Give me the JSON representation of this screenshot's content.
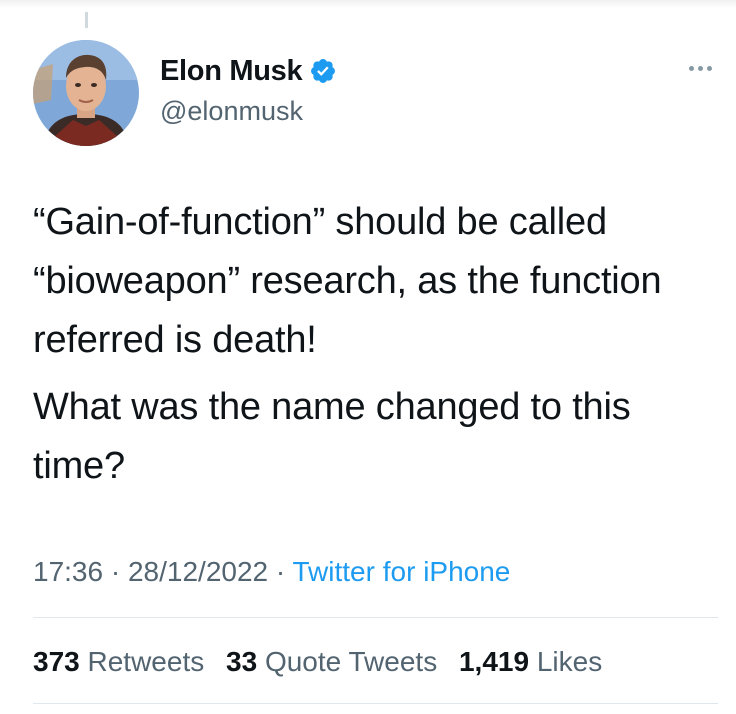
{
  "tweet": {
    "author": {
      "display_name": "Elon Musk",
      "handle": "@elonmusk",
      "verified": true
    },
    "text": [
      "“Gain-of-function” should be called “bioweapon” research, as the function referred is death!",
      "What was the name changed to this time?"
    ],
    "time": "17:36",
    "date": "28/12/2022",
    "separator": "·",
    "source": "Twitter for iPhone",
    "stats": {
      "retweets_count": "373",
      "retweets_label": "Retweets",
      "quotes_count": "33",
      "quotes_label": "Quote Tweets",
      "likes_count": "1,419",
      "likes_label": "Likes"
    }
  },
  "colors": {
    "text": "#0f1419",
    "secondary": "#536471",
    "accent": "#1d9bf0",
    "divider": "#e1e8ed"
  },
  "icons": {
    "verified": "verified-badge-icon",
    "more": "more-options-icon"
  }
}
